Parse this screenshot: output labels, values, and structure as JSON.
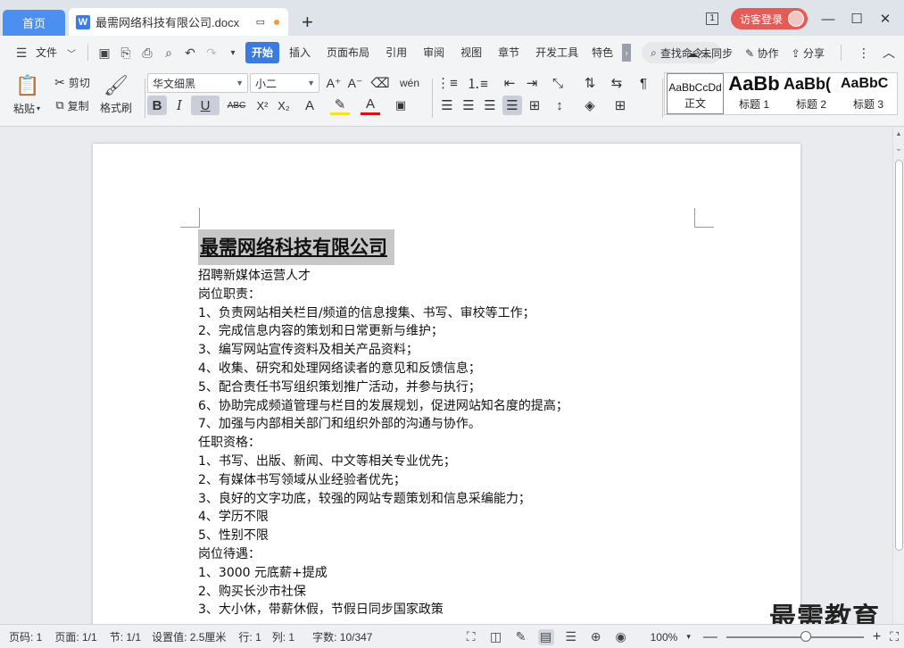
{
  "tabs": {
    "home": "首页",
    "doc_icon": "W",
    "doc": "最需网络科技有限公司.docx"
  },
  "titlebar": {
    "page_count": "1",
    "login": "访客登录"
  },
  "menu": {
    "file": "文件",
    "items": [
      "开始",
      "插入",
      "页面布局",
      "引用",
      "审阅",
      "视图",
      "章节",
      "开发工具",
      "特色"
    ],
    "active_index": 0,
    "search": "查找命令...",
    "sync": "未同步",
    "collab": "协作",
    "share": "分享"
  },
  "ribbon": {
    "paste": "粘贴",
    "cut": "剪切",
    "copy": "复制",
    "format_painter": "格式刷",
    "font_name": "华文细黑",
    "font_size": "小二",
    "bold": "B",
    "italic": "I",
    "underline": "U",
    "abc": "ABC",
    "sup": "X²",
    "sub": "X₂",
    "styles": [
      {
        "preview": "AaBbCcDd",
        "label": "正文"
      },
      {
        "preview": "AaBb",
        "label": "标题 1"
      },
      {
        "preview": "AaBb(",
        "label": "标题 2"
      },
      {
        "preview": "AaBbC",
        "label": "标题 3"
      }
    ]
  },
  "document": {
    "title": "最需网络科技有限公司",
    "lines": [
      "招聘新媒体运营人才",
      "岗位职责：",
      "1、负责网站相关栏目/频道的信息搜集、书写、审校等工作；",
      "2、完成信息内容的策划和日常更新与维护；",
      "3、编写网站宣传资料及相关产品资料；",
      "4、收集、研究和处理网络读者的意见和反馈信息；",
      "5、配合责任书写组织策划推广活动，并参与执行；",
      "6、协助完成频道管理与栏目的发展规划，促进网站知名度的提高；",
      "7、加强与内部相关部门和组织外部的沟通与协作。",
      "任职资格：",
      "1、书写、出版、新闻、中文等相关专业优先；",
      "2、有媒体书写领域从业经验者优先；",
      "3、良好的文字功底，较强的网站专题策划和信息采编能力；",
      "4、学历不限",
      "5、性别不限",
      "岗位待遇：",
      "1、3000 元底薪+提成",
      "2、购买长沙市社保",
      "3、大小休，带薪休假，节假日同步国家政策"
    ]
  },
  "watermark": "最需教育",
  "status": {
    "page_no": "页码: 1",
    "pages": "页面: 1/1",
    "section": "节: 1/1",
    "setting": "设置值: 2.5厘米",
    "row": "行: 1",
    "col": "列: 1",
    "words": "字数: 10/347",
    "zoom": "100%",
    "zoom_fraction": 0.58
  }
}
